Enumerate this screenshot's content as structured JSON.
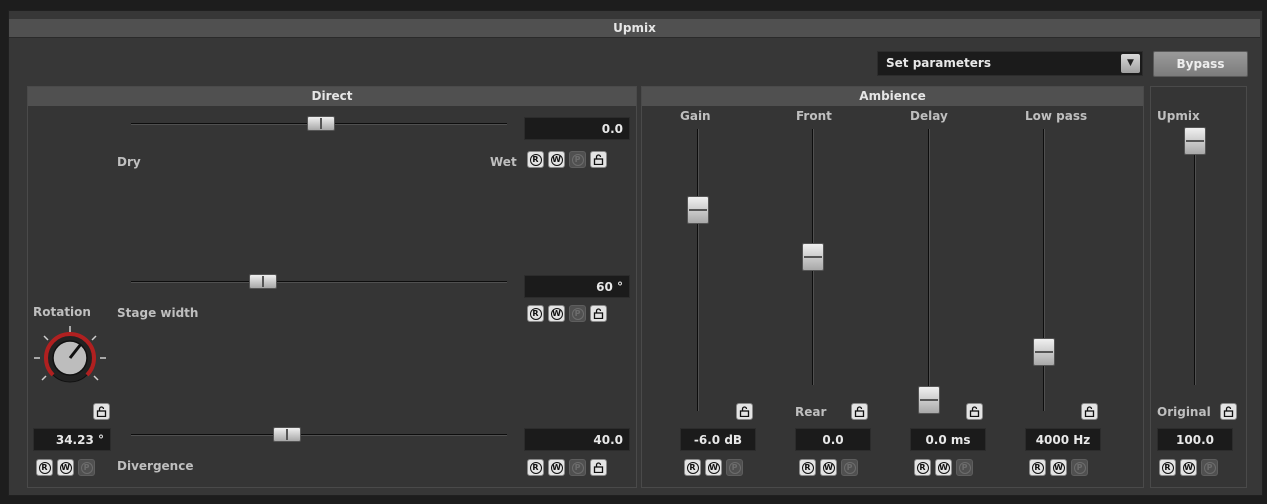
{
  "title": "Upmix",
  "preset": {
    "value": "Set parameters"
  },
  "bypass_label": "Bypass",
  "direct": {
    "title": "Direct",
    "drywet": {
      "left_label": "Dry",
      "right_label": "Wet",
      "value": "0.0"
    },
    "stage_width": {
      "label": "Stage width",
      "value": "60 °"
    },
    "divergence": {
      "label": "Divergence",
      "value": "40.0"
    },
    "rotation": {
      "label": "Rotation",
      "value": "34.23 °"
    }
  },
  "ambience": {
    "title": "Ambience",
    "gain": {
      "label": "Gain",
      "value": "-6.0 dB"
    },
    "front": {
      "label": "Front",
      "bottom_label": "Rear",
      "value": "0.0"
    },
    "delay": {
      "label": "Delay",
      "value": "0.0 ms"
    },
    "lowpass": {
      "label": "Low pass",
      "value": "4000 Hz"
    }
  },
  "upmix": {
    "label": "Upmix",
    "bottom_label": "Original",
    "value": "100.0"
  },
  "rwp": {
    "r": "R",
    "w": "W",
    "p": "P"
  }
}
